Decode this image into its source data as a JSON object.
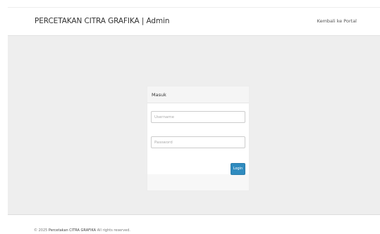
{
  "header": {
    "brand": "PERCETAKAN CITRA GRAFIKA | Admin",
    "portal_link": "Kembali ke Portal"
  },
  "login": {
    "title": "Masuk",
    "username_placeholder": "Username",
    "password_placeholder": "Password",
    "submit_label": "Login"
  },
  "footer": {
    "prefix": "© 2025",
    "company": "Percetakan CITRA GRAFIKA",
    "suffix": "All rights reserved."
  },
  "colors": {
    "band_background": "#eeeeee",
    "primary_button": "#2f8bbf"
  }
}
